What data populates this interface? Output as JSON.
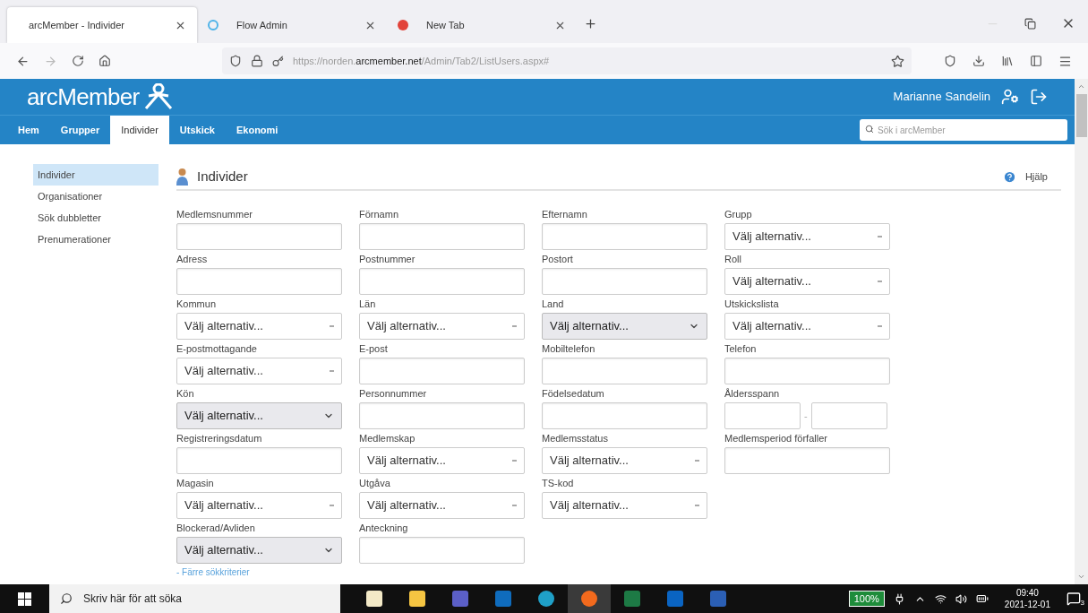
{
  "browser": {
    "tabs": [
      {
        "title": "arcMember - Individer",
        "selected": true
      },
      {
        "title": "Flow Admin",
        "selected": false
      },
      {
        "title": "New Tab",
        "selected": false
      }
    ],
    "url_host": "https://norden.",
    "url_domain": "arcmember.net",
    "url_path": "/Admin/Tab2/ListUsers.aspx#"
  },
  "header": {
    "logo": "arcMember",
    "user": "Marianne Sandelin",
    "nav": [
      {
        "label": "Hem",
        "selected": false
      },
      {
        "label": "Grupper",
        "selected": false
      },
      {
        "label": "Individer",
        "selected": true
      },
      {
        "label": "Utskick",
        "selected": false
      },
      {
        "label": "Ekonomi",
        "selected": false
      }
    ],
    "search": {
      "placeholder": "Sök i arcMember"
    }
  },
  "sidebar": {
    "items": [
      {
        "label": "Individer",
        "selected": true
      },
      {
        "label": "Organisationer",
        "selected": false
      },
      {
        "label": "Sök dubbletter",
        "selected": false
      },
      {
        "label": "Prenumerationer",
        "selected": false
      }
    ]
  },
  "page": {
    "title": "Individer",
    "help": "Hjälp"
  },
  "form": {
    "rows": [
      {
        "fields": [
          {
            "label": "Medlemsnummer",
            "kind": "text"
          },
          {
            "label": "Förnamn",
            "kind": "text"
          },
          {
            "label": "Efternamn",
            "kind": "text"
          },
          {
            "label": "Grupp",
            "kind": "select",
            "value": "Välj alternativ..."
          }
        ]
      },
      {
        "fields": [
          {
            "label": "Adress",
            "kind": "text"
          },
          {
            "label": "Postnummer",
            "kind": "text"
          },
          {
            "label": "Postort",
            "kind": "text"
          },
          {
            "label": "Roll",
            "kind": "select",
            "value": "Välj alternativ..."
          }
        ]
      },
      {
        "fields": [
          {
            "label": "Kommun",
            "kind": "select",
            "value": "Välj alternativ..."
          },
          {
            "label": "Län",
            "kind": "select",
            "value": "Välj alternativ..."
          },
          {
            "label": "Land",
            "kind": "native-select",
            "value": "Välj alternativ..."
          },
          {
            "label": "Utskickslista",
            "kind": "select",
            "value": "Välj alternativ..."
          }
        ]
      },
      {
        "fields": [
          {
            "label": "E-postmottagande",
            "kind": "select",
            "value": "Välj alternativ..."
          },
          {
            "label": "E-post",
            "kind": "text"
          },
          {
            "label": "Mobiltelefon",
            "kind": "text"
          },
          {
            "label": "Telefon",
            "kind": "text"
          }
        ]
      },
      {
        "fields": [
          {
            "label": "Kön",
            "kind": "native-select",
            "value": "Välj alternativ..."
          },
          {
            "label": "Personnummer",
            "kind": "text"
          },
          {
            "label": "Födelsedatum",
            "kind": "text"
          },
          {
            "label": "Åldersspann",
            "kind": "range",
            "separator": "-"
          }
        ]
      },
      {
        "fields": [
          {
            "label": "Registreringsdatum",
            "kind": "text"
          },
          {
            "label": "Medlemskap",
            "kind": "select",
            "value": "Välj alternativ..."
          },
          {
            "label": "Medlemsstatus",
            "kind": "select",
            "value": "Välj alternativ..."
          },
          {
            "label": "Medlemsperiod förfaller",
            "kind": "text"
          }
        ]
      },
      {
        "fields": [
          {
            "label": "Magasin",
            "kind": "select",
            "value": "Välj alternativ..."
          },
          {
            "label": "Utgåva",
            "kind": "select",
            "value": "Välj alternativ..."
          },
          {
            "label": "TS-kod",
            "kind": "select",
            "value": "Välj alternativ..."
          }
        ]
      },
      {
        "fields": [
          {
            "label": "Blockerad/Avliden",
            "kind": "native-select",
            "value": "Välj alternativ..."
          },
          {
            "label": "Anteckning",
            "kind": "text"
          }
        ]
      }
    ],
    "less_link": "- Färre sökkriterier"
  },
  "taskbar": {
    "search_placeholder": "Skriv här för att söka",
    "apps": [
      {
        "selected": false
      },
      {
        "selected": false
      },
      {
        "selected": false
      },
      {
        "selected": false
      },
      {
        "selected": false
      },
      {
        "selected": true
      },
      {
        "selected": false
      },
      {
        "selected": false
      },
      {
        "selected": false
      }
    ],
    "battery": "100%",
    "time": "09:40",
    "date": "2021-12-01",
    "notifications": "3"
  }
}
